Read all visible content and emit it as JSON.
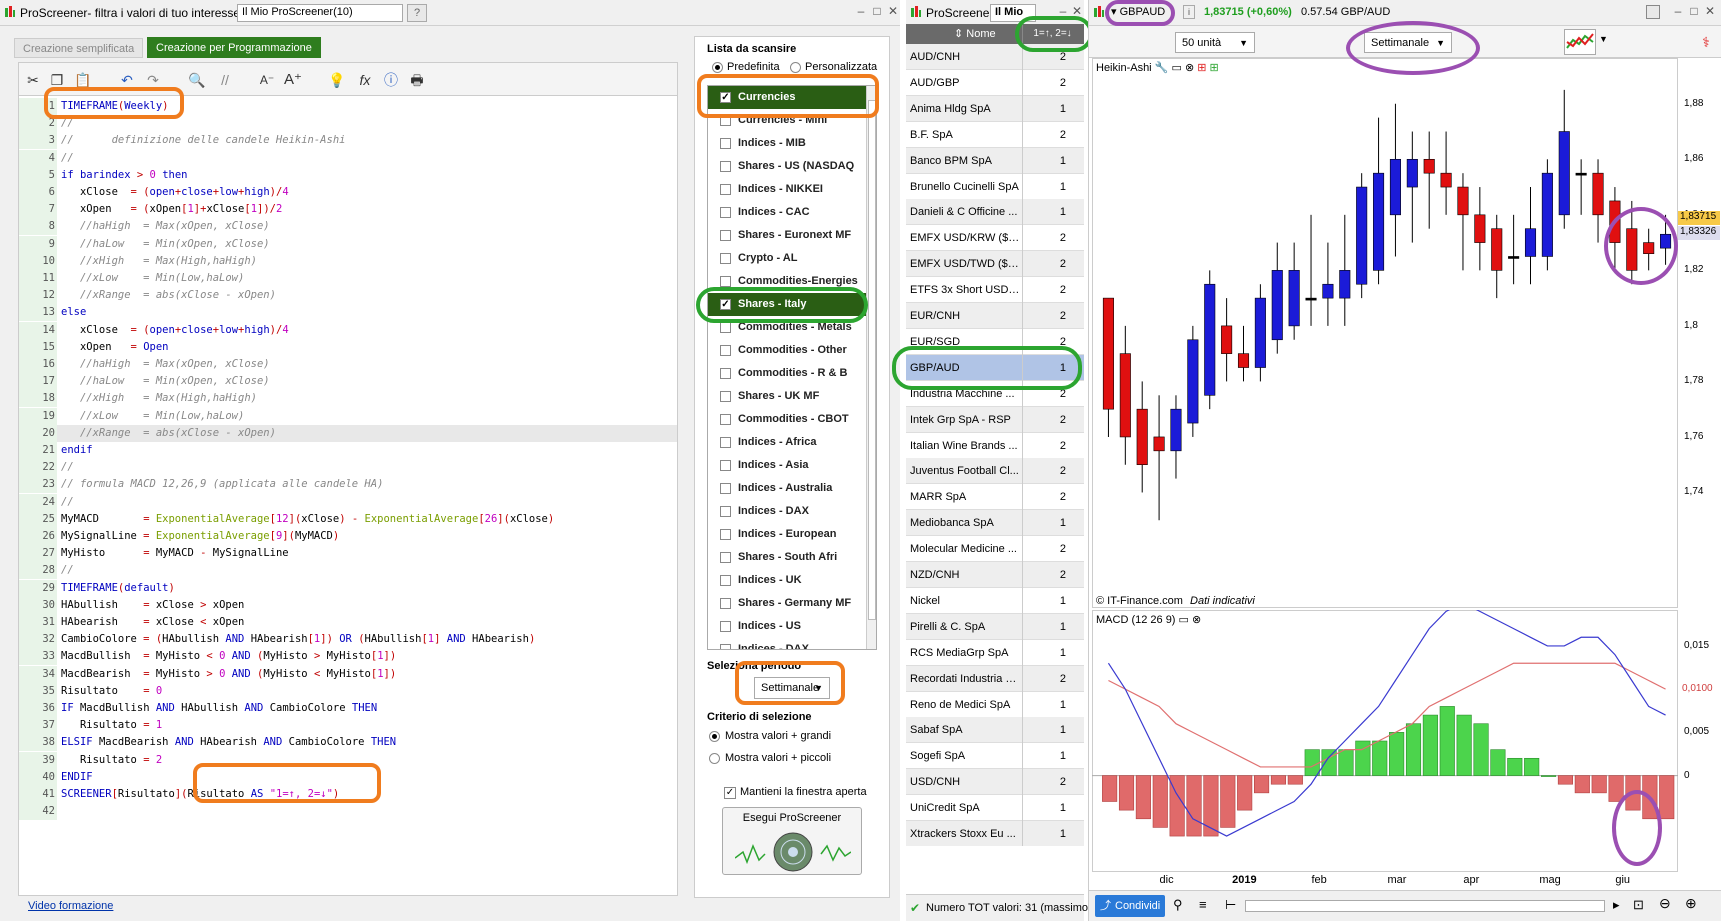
{
  "editor": {
    "title": "ProScreener- filtra i valori di tuo interesse",
    "name_value": "Il Mio ProScreener(10)",
    "tabs": [
      "Creazione semplificata",
      "Creazione per Programmazione"
    ],
    "code_lines": [
      "TIMEFRAME(Weekly)",
      "//",
      "//      definizione delle candele Heikin-Ashi",
      "//",
      "if barindex > 0 then",
      "   xClose  = (open+close+low+high)/4",
      "   xOpen   = (xOpen[1]+xClose[1])/2",
      "   //haHigh  = Max(xOpen, xClose)",
      "   //haLow   = Min(xOpen, xClose)",
      "   //xHigh   = Max(High,haHigh)",
      "   //xLow    = Min(Low,haLow)",
      "   //xRange  = abs(xClose - xOpen)",
      "else",
      "   xClose  = (open+close+low+high)/4",
      "   xOpen   = Open",
      "   //haHigh  = Max(xOpen, xClose)",
      "   //haLow   = Min(xOpen, xClose)",
      "   //xHigh   = Max(High,haHigh)",
      "   //xLow    = Min(Low,haLow)",
      "   //xRange  = abs(xClose - xOpen)",
      "endif",
      "//",
      "// formula MACD 12,26,9 (applicata alle candele HA)",
      "//",
      "MyMACD       = ExponentialAverage[12](xClose) - ExponentialAverage[26](xClose)",
      "MySignalLine = ExponentialAverage[9](MyMACD)",
      "MyHisto      = MyMACD - MySignalLine",
      "//",
      "TIMEFRAME(default)",
      "HAbullish    = xClose > xOpen",
      "HAbearish    = xClose < xOpen",
      "CambioColore = (HAbullish AND HAbearish[1]) OR (HAbullish[1] AND HAbearish)",
      "MacdBullish  = MyHisto < 0 AND (MyHisto > MyHisto[1])",
      "MacdBearish  = MyHisto > 0 AND (MyHisto < MyHisto[1])",
      "Risultato    = 0",
      "IF MacdBullish AND HAbullish AND CambioColore THEN",
      "   Risultato = 1",
      "ELSIF MacdBearish AND HAbearish AND CambioColore THEN",
      "   Risultato = 2",
      "ENDIF",
      "SCREENER[Risultato](Risultato AS \"1=↑, 2=↓\")",
      ""
    ],
    "footer_link": "Video formazione"
  },
  "settings": {
    "list_title": "Lista da scansire",
    "radio_predefinita": "Predefinita",
    "radio_personalizzata": "Personalizzata",
    "list_items": [
      {
        "label": "Currencies",
        "checked": true
      },
      {
        "label": "Currencies - Mini",
        "checked": false
      },
      {
        "label": "Indices - MIB",
        "checked": false
      },
      {
        "label": "Shares - US (NASDAQ",
        "checked": false
      },
      {
        "label": "Indices - NIKKEI",
        "checked": false
      },
      {
        "label": "Indices - CAC",
        "checked": false
      },
      {
        "label": "Shares - Euronext MF",
        "checked": false
      },
      {
        "label": "Crypto - AL",
        "checked": false
      },
      {
        "label": "Commodities-Energies",
        "checked": false
      },
      {
        "label": "Shares - Italy",
        "checked": true
      },
      {
        "label": "Commodities - Metals",
        "checked": false
      },
      {
        "label": "Commodities - Other",
        "checked": false
      },
      {
        "label": "Commodities - R & B",
        "checked": false
      },
      {
        "label": "Shares - UK MF",
        "checked": false
      },
      {
        "label": "Commodities - CBOT",
        "checked": false
      },
      {
        "label": "Indices - Africa",
        "checked": false
      },
      {
        "label": "Indices - Asia",
        "checked": false
      },
      {
        "label": "Indices - Australia",
        "checked": false
      },
      {
        "label": "Indices - DAX",
        "checked": false
      },
      {
        "label": "Indices - European",
        "checked": false
      },
      {
        "label": "Shares - South Afri",
        "checked": false
      },
      {
        "label": "Indices - UK",
        "checked": false
      },
      {
        "label": "Shares - Germany MF",
        "checked": false
      },
      {
        "label": "Indices - US",
        "checked": false
      },
      {
        "label": "Indices - DAX",
        "checked": false
      }
    ],
    "period_label": "Seleziona periodo",
    "period_value": "Settimanale",
    "criterion_label": "Criterio di selezione",
    "criterion_greater": "Mostra valori + grandi",
    "criterion_smaller": "Mostra valori + piccoli",
    "keep_open": "Mantieni la finestra aperta",
    "run_button": "Esegui ProScreener"
  },
  "results": {
    "title": "ProScreener",
    "title2": "Il Mio",
    "col_name": "Nome",
    "col_result": "1=↑, 2=↓",
    "rows": [
      {
        "name": "AUD/CNH",
        "value": "2"
      },
      {
        "name": "AUD/GBP",
        "value": "2"
      },
      {
        "name": "Anima Hldg SpA",
        "value": "1"
      },
      {
        "name": "B.F. SpA",
        "value": "2"
      },
      {
        "name": "Banco BPM SpA",
        "value": "1"
      },
      {
        "name": "Brunello Cucinelli SpA",
        "value": "1"
      },
      {
        "name": "Danieli & C Officine ...",
        "value": "1"
      },
      {
        "name": "EMFX USD/KRW ($10)",
        "value": "2"
      },
      {
        "name": "EMFX USD/TWD ($10)",
        "value": "2"
      },
      {
        "name": "ETFS 3x Short USD ...",
        "value": "2"
      },
      {
        "name": "EUR/CNH",
        "value": "2"
      },
      {
        "name": "EUR/SGD",
        "value": "2"
      },
      {
        "name": "GBP/AUD",
        "value": "1"
      },
      {
        "name": "Industria Macchine ...",
        "value": "2"
      },
      {
        "name": "Intek Grp SpA - RSP",
        "value": "2"
      },
      {
        "name": "Italian Wine Brands ...",
        "value": "2"
      },
      {
        "name": "Juventus Football Cl...",
        "value": "2"
      },
      {
        "name": "MARR SpA",
        "value": "2"
      },
      {
        "name": "Mediobanca SpA",
        "value": "1"
      },
      {
        "name": "Molecular Medicine ...",
        "value": "2"
      },
      {
        "name": "NZD/CNH",
        "value": "2"
      },
      {
        "name": "Nickel",
        "value": "1"
      },
      {
        "name": "Pirelli & C. SpA",
        "value": "1"
      },
      {
        "name": "RCS MediaGrp SpA",
        "value": "1"
      },
      {
        "name": "Recordati Industria C...",
        "value": "2"
      },
      {
        "name": "Reno de Medici SpA",
        "value": "1"
      },
      {
        "name": "Sabaf SpA",
        "value": "1"
      },
      {
        "name": "Sogefi SpA",
        "value": "1"
      },
      {
        "name": "USD/CNH",
        "value": "2"
      },
      {
        "name": "UniCredit SpA",
        "value": "1"
      },
      {
        "name": "Xtrackers Stoxx Eu ...",
        "value": "1"
      }
    ],
    "selected_index": 12,
    "status": "Numero TOT valori: 31 (massimo"
  },
  "chart": {
    "symbol": "GBPAUD",
    "price_change": "1,83715 (+0,60%)",
    "time_pair": "0.57.54 GBP/AUD",
    "units": "50 unità",
    "timeframe": "Settimanale",
    "main_label": "Heikin-Ashi",
    "copyright": "© IT-Finance.com",
    "indicative": "Dati indicativi",
    "macd_label": "MACD (12 26 9)",
    "share_label": "Condividi",
    "price_axis": [
      "1,88",
      "1,86",
      "1,84",
      "1,82",
      "1,8",
      "1,78",
      "1,76",
      "1,74"
    ],
    "price_tag_last": "1,83715",
    "price_tag_other": "1,83326",
    "macd_axis": [
      "0,015",
      "0,010",
      "0,005",
      "0"
    ],
    "macd_tag": "0,0100",
    "x_labels": [
      "dic",
      "2019",
      "feb",
      "mar",
      "apr",
      "mag",
      "giu"
    ],
    "colors": {
      "bull": "#1b1bd8",
      "bear": "#e01010",
      "hist_pos": "#4cd44c",
      "hist_neg": "#e06a6a",
      "macd": "#3a3ad0",
      "signal": "#e07070"
    }
  },
  "chart_data": {
    "type": "candlestick",
    "title": "GBPAUD",
    "ylim": [
      1.72,
      1.89
    ],
    "candles": [
      {
        "o": 1.81,
        "c": 1.77,
        "h": 1.81,
        "l": 1.76
      },
      {
        "o": 1.79,
        "c": 1.76,
        "h": 1.8,
        "l": 1.75
      },
      {
        "o": 1.77,
        "c": 1.75,
        "h": 1.78,
        "l": 1.74
      },
      {
        "o": 1.76,
        "c": 1.755,
        "h": 1.775,
        "l": 1.73
      },
      {
        "o": 1.755,
        "c": 1.77,
        "h": 1.775,
        "l": 1.745
      },
      {
        "o": 1.765,
        "c": 1.795,
        "h": 1.8,
        "l": 1.76
      },
      {
        "o": 1.775,
        "c": 1.815,
        "h": 1.82,
        "l": 1.77
      },
      {
        "o": 1.8,
        "c": 1.79,
        "h": 1.81,
        "l": 1.78
      },
      {
        "o": 1.79,
        "c": 1.785,
        "h": 1.8,
        "l": 1.78
      },
      {
        "o": 1.785,
        "c": 1.81,
        "h": 1.815,
        "l": 1.78
      },
      {
        "o": 1.795,
        "c": 1.82,
        "h": 1.83,
        "l": 1.79
      },
      {
        "o": 1.8,
        "c": 1.82,
        "h": 1.83,
        "l": 1.795
      },
      {
        "o": 1.81,
        "c": 1.81,
        "h": 1.84,
        "l": 1.8
      },
      {
        "o": 1.81,
        "c": 1.815,
        "h": 1.83,
        "l": 1.8
      },
      {
        "o": 1.81,
        "c": 1.82,
        "h": 1.84,
        "l": 1.8
      },
      {
        "o": 1.815,
        "c": 1.85,
        "h": 1.855,
        "l": 1.81
      },
      {
        "o": 1.82,
        "c": 1.855,
        "h": 1.875,
        "l": 1.815
      },
      {
        "o": 1.84,
        "c": 1.86,
        "h": 1.88,
        "l": 1.825
      },
      {
        "o": 1.85,
        "c": 1.86,
        "h": 1.87,
        "l": 1.83
      },
      {
        "o": 1.86,
        "c": 1.855,
        "h": 1.87,
        "l": 1.835
      },
      {
        "o": 1.855,
        "c": 1.85,
        "h": 1.87,
        "l": 1.84
      },
      {
        "o": 1.85,
        "c": 1.84,
        "h": 1.855,
        "l": 1.82
      },
      {
        "o": 1.84,
        "c": 1.83,
        "h": 1.85,
        "l": 1.82
      },
      {
        "o": 1.835,
        "c": 1.82,
        "h": 1.84,
        "l": 1.81
      },
      {
        "o": 1.825,
        "c": 1.825,
        "h": 1.84,
        "l": 1.815
      },
      {
        "o": 1.825,
        "c": 1.835,
        "h": 1.85,
        "l": 1.815
      },
      {
        "o": 1.825,
        "c": 1.855,
        "h": 1.86,
        "l": 1.82
      },
      {
        "o": 1.84,
        "c": 1.87,
        "h": 1.885,
        "l": 1.835
      },
      {
        "o": 1.855,
        "c": 1.855,
        "h": 1.86,
        "l": 1.84
      },
      {
        "o": 1.855,
        "c": 1.84,
        "h": 1.86,
        "l": 1.83
      },
      {
        "o": 1.845,
        "c": 1.83,
        "h": 1.85,
        "l": 1.82
      },
      {
        "o": 1.835,
        "c": 1.82,
        "h": 1.845,
        "l": 1.815
      },
      {
        "o": 1.83,
        "c": 1.826,
        "h": 1.835,
        "l": 1.82
      },
      {
        "o": 1.828,
        "c": 1.833,
        "h": 1.84,
        "l": 1.822
      }
    ],
    "macd": {
      "macd_line": [
        0.013,
        0.01,
        0.006,
        0.002,
        -0.002,
        -0.005,
        -0.006,
        -0.007,
        -0.006,
        -0.005,
        -0.004,
        -0.003,
        -0.001,
        0.002,
        0.004,
        0.006,
        0.008,
        0.011,
        0.014,
        0.017,
        0.019,
        0.02,
        0.019,
        0.018,
        0.017,
        0.016,
        0.015,
        0.015,
        0.016,
        0.016,
        0.014,
        0.011,
        0.008,
        0.007
      ],
      "signal_line": [
        0.011,
        0.01,
        0.009,
        0.008,
        0.006,
        0.005,
        0.004,
        0.003,
        0.002,
        0.001,
        0.001,
        0.001,
        0.001,
        0.002,
        0.003,
        0.003,
        0.004,
        0.005,
        0.006,
        0.008,
        0.009,
        0.01,
        0.011,
        0.012,
        0.013,
        0.013,
        0.013,
        0.013,
        0.013,
        0.013,
        0.013,
        0.012,
        0.011,
        0.01
      ],
      "histogram": [
        -0.003,
        -0.004,
        -0.005,
        -0.006,
        -0.007,
        -0.007,
        -0.007,
        -0.006,
        -0.004,
        -0.002,
        -0.001,
        -0.001,
        0.003,
        0.003,
        0.003,
        0.004,
        0.004,
        0.005,
        0.006,
        0.007,
        0.008,
        0.007,
        0.006,
        0.003,
        0.002,
        0.002,
        0.0,
        -0.001,
        -0.002,
        -0.002,
        -0.003,
        -0.004,
        -0.005,
        -0.005
      ],
      "ylim": [
        -0.01,
        0.018
      ]
    }
  }
}
